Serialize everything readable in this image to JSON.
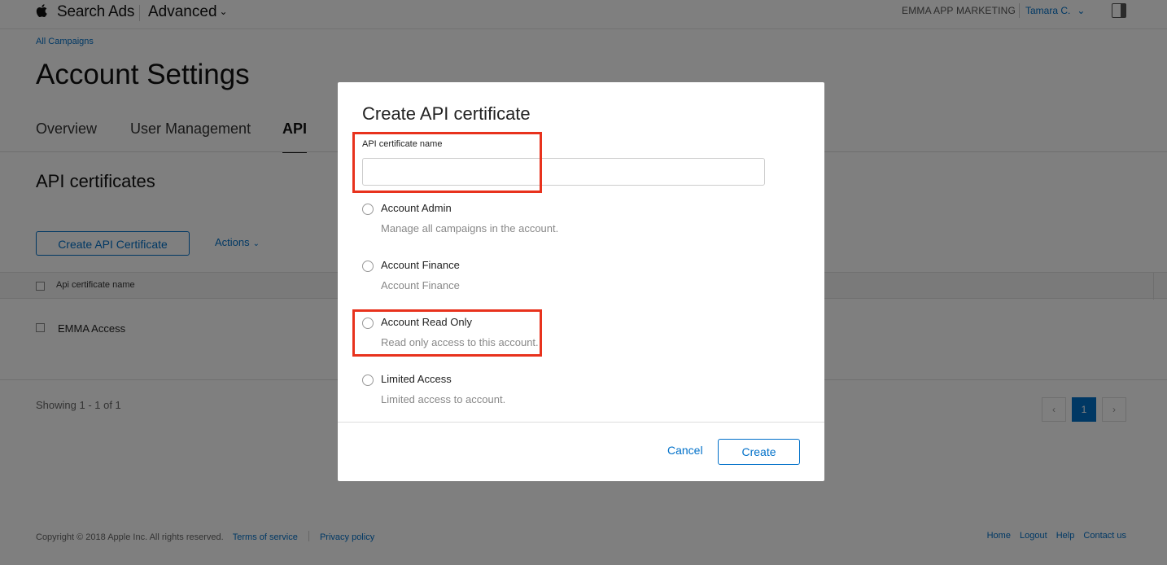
{
  "header": {
    "brand": "Search Ads",
    "mode": "Advanced",
    "org": "EMMA APP MARKETING",
    "user": "Tamara C."
  },
  "breadcrumb": "All Campaigns",
  "page_title": "Account Settings",
  "tabs": [
    {
      "label": "Overview",
      "active": false
    },
    {
      "label": "User Management",
      "active": false
    },
    {
      "label": "API",
      "active": true
    }
  ],
  "section_title": "API certificates",
  "toolbar": {
    "create_label": "Create API Certificate",
    "actions_label": "Actions"
  },
  "table": {
    "column_header": "Api certificate name",
    "rows": [
      {
        "name": "EMMA Access"
      }
    ]
  },
  "pagination": {
    "showing": "Showing 1 - 1 of 1",
    "current_page": "1"
  },
  "footer": {
    "copyright": "Copyright © 2018 Apple Inc. All rights reserved.",
    "terms": "Terms of service",
    "privacy": "Privacy policy",
    "links": [
      "Home",
      "Logout",
      "Help",
      "Contact us"
    ]
  },
  "modal": {
    "title": "Create API certificate",
    "field_label": "API certificate name",
    "field_value": "",
    "options": [
      {
        "title": "Account Admin",
        "description": "Manage all campaigns in the account."
      },
      {
        "title": "Account Finance",
        "description": "Account Finance"
      },
      {
        "title": "Account Read Only",
        "description": "Read only access to this account."
      },
      {
        "title": "Limited Access",
        "description": "Limited access to account."
      }
    ],
    "cancel_label": "Cancel",
    "create_label": "Create"
  },
  "colors": {
    "link": "#0070c9",
    "highlight": "#e8321d",
    "overlay": "rgba(0,0,0,0.5)"
  },
  "icons": [
    "apple-logo-icon",
    "chevron-down-icon",
    "sidebar-panel-icon",
    "chevron-left-icon",
    "chevron-right-icon"
  ]
}
